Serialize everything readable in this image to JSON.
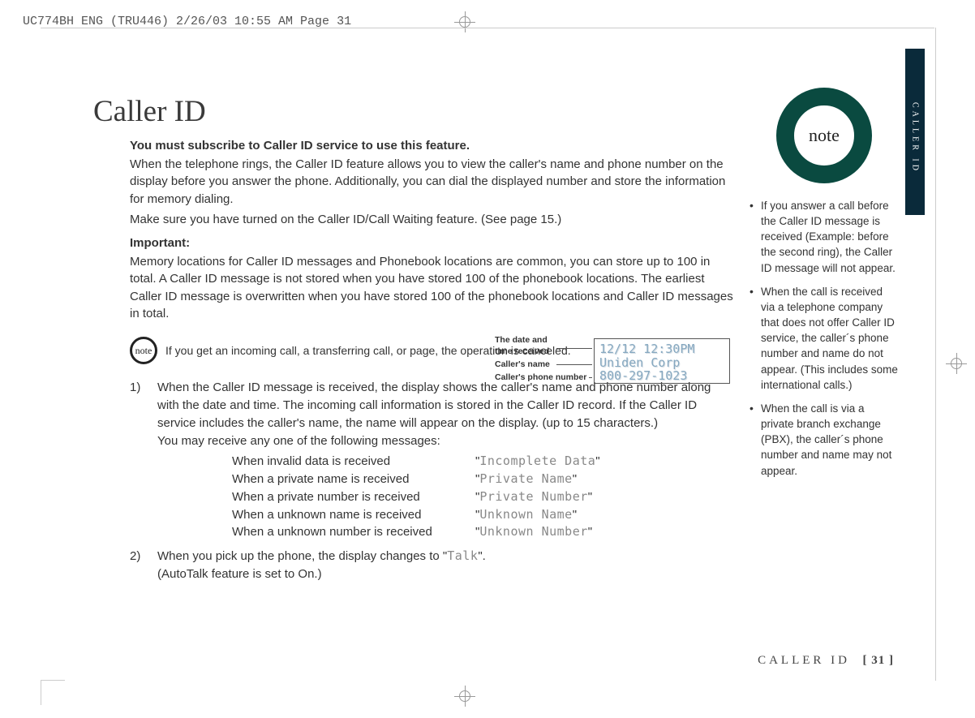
{
  "header_line": "UC774BH ENG (TRU446)  2/26/03  10:55 AM  Page 31",
  "side_tab": "CALLER ID",
  "title": "Caller ID",
  "bold_intro": "You must subscribe to Caller ID service to use this feature.",
  "para1": "When the telephone rings, the Caller ID feature allows you to view the caller's name and phone number on the display before you answer the phone. Additionally, you can dial the displayed number and store the information for memory dialing.",
  "para1b": "Make sure you have turned on the Caller ID/Call Waiting feature. (See page 15.)",
  "important_label": "Important:",
  "important_body": "Memory locations for Caller ID messages and Phonebook locations are common, you can store up to 100 in total. A Caller ID message is not stored when you have stored 100 of the phonebook locations. The earliest Caller ID message is overwritten when you have stored 100 of the phonebook locations and Caller ID messages in total.",
  "inline_note_badge": "note",
  "inline_note_text": "If you get an incoming call, a transferring call, or page, the operation is canceled.",
  "step1_num": "1)",
  "step1_a": "When the Caller ID message is received, the display shows the caller's name and phone number along with the date and time. The incoming call information is stored in the Caller ID record. If the Caller ID service includes the caller's name, the name will appear on the display. (up to 15 characters.)",
  "step1_b": "You may receive any one of the following messages:",
  "callout": {
    "l1": "The date and",
    "l1b": "time received",
    "l2": "Caller's name",
    "l3": "Caller's phone number"
  },
  "lcd": {
    "line1": "12/12 12:30PM",
    "line2": "Uniden Corp",
    "line3": "800-297-1023"
  },
  "messages": [
    {
      "c1": "When invalid data is received",
      "c2": "Incomplete Data"
    },
    {
      "c1": "When a private name is received",
      "c2": "Private Name"
    },
    {
      "c1": "When a private number is received",
      "c2": "Private Number"
    },
    {
      "c1": "When a unknown name is received",
      "c2": "Unknown Name"
    },
    {
      "c1": "When a unknown number is received",
      "c2": "Unknown Number"
    }
  ],
  "step2_num": "2)",
  "step2_a": "When you pick up the phone, the display changes to \"",
  "step2_talk": "Talk",
  "step2_b": "\".",
  "step2_c": "(AutoTalk feature is set to On.)",
  "side_note_badge": "note",
  "side_items": [
    "If you answer a call before the Caller ID message is received (Example: before the second ring), the Caller ID message will not appear.",
    "When the call is received via a telephone company that does not offer Caller ID service, the caller´s phone number and name do not appear. (This includes some international calls.)",
    "When the call is via a private branch exchange (PBX), the caller´s phone number and name may not appear."
  ],
  "footer_section": "CALLER ID",
  "footer_page": "[ 31 ]"
}
